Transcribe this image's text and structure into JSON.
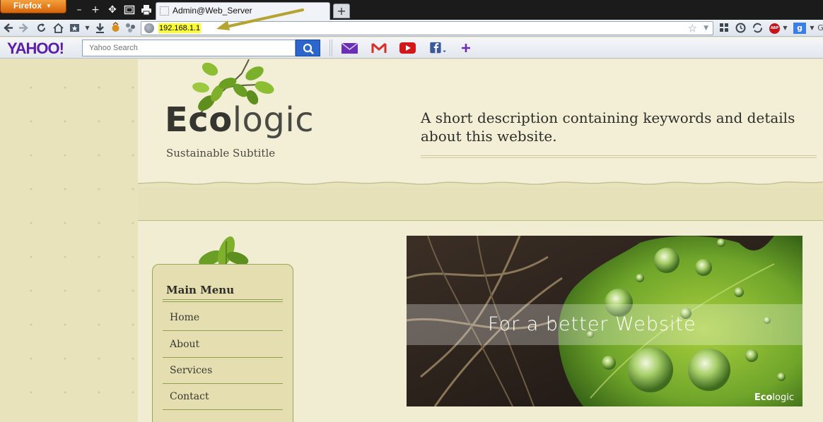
{
  "browser": {
    "firefox_button": "Firefox",
    "tab_title": "Admin@Web_Server",
    "new_tab_symbol": "+",
    "url": "192.168.1.1",
    "google_letter": "g",
    "search_partial": "G"
  },
  "yahoo_toolbar": {
    "logo": "YAHOO!",
    "search_placeholder": "Yahoo Search",
    "icons": [
      "mail-icon",
      "gmail-icon",
      "youtube-icon",
      "facebook-icon",
      "add-icon"
    ]
  },
  "site": {
    "logo_bold": "Eco",
    "logo_light": "logic",
    "subtitle": "Sustainable Subtitle",
    "description": "A short description containing keywords and details about this website.",
    "menu": {
      "title": "Main Menu",
      "items": [
        "Home",
        "About",
        "Services",
        "Contact"
      ]
    },
    "banner": {
      "caption": "For a better Website",
      "brand_bold": "Eco",
      "brand_light": "logic"
    }
  },
  "colors": {
    "page_bg": "#e8e3ba",
    "header_bg": "#f3efd7",
    "menu_border": "#8ea152",
    "url_highlight": "#ffff33",
    "yahoo_purple": "#5a1ea8"
  }
}
